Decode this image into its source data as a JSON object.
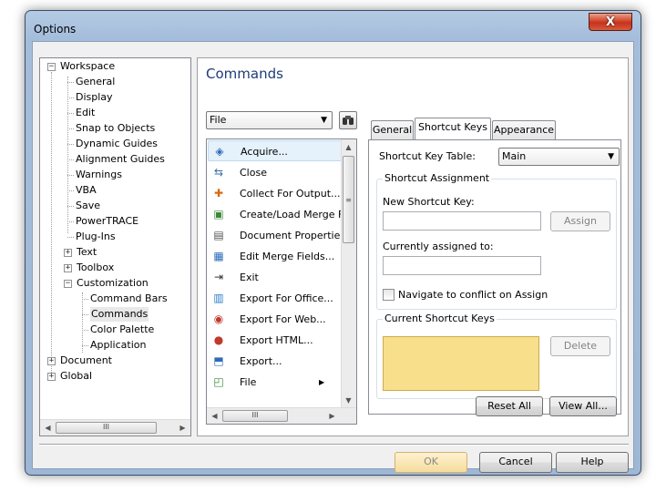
{
  "window": {
    "title": "Options",
    "close_glyph": "X"
  },
  "tree": {
    "items": [
      {
        "label": "Workspace",
        "expander": "−"
      },
      {
        "label": "General"
      },
      {
        "label": "Display"
      },
      {
        "label": "Edit"
      },
      {
        "label": "Snap to Objects"
      },
      {
        "label": "Dynamic Guides"
      },
      {
        "label": "Alignment Guides"
      },
      {
        "label": "Warnings"
      },
      {
        "label": "VBA"
      },
      {
        "label": "Save"
      },
      {
        "label": "PowerTRACE"
      },
      {
        "label": "Plug-Ins"
      },
      {
        "label": "Text",
        "expander": "+"
      },
      {
        "label": "Toolbox",
        "expander": "+"
      },
      {
        "label": "Customization",
        "expander": "−"
      },
      {
        "label": "Command Bars"
      },
      {
        "label": "Commands"
      },
      {
        "label": "Color Palette"
      },
      {
        "label": "Application"
      },
      {
        "label": "Document",
        "expander": "+"
      },
      {
        "label": "Global",
        "expander": "+"
      }
    ],
    "scroll_thumb_glyph": "III"
  },
  "main": {
    "heading": "Commands",
    "category_select": {
      "value": "File"
    },
    "find_icon": "binoculars-icon",
    "commands": [
      {
        "label": "Acquire...",
        "icon": "acquire-icon",
        "glyph": "◈",
        "color": "#2e6bb8"
      },
      {
        "label": "Close",
        "icon": "close-document-icon",
        "glyph": "⇆",
        "color": "#3a6ea5"
      },
      {
        "label": "Collect For Output...",
        "icon": "collect-output-icon",
        "glyph": "✚",
        "color": "#d66a10"
      },
      {
        "label": "Create/Load Merge Fie",
        "icon": "merge-create-icon",
        "glyph": "▣",
        "color": "#3a8a3a"
      },
      {
        "label": "Document Properties...",
        "icon": "document-properties-icon",
        "glyph": "▤",
        "color": "#555555"
      },
      {
        "label": "Edit Merge Fields...",
        "icon": "edit-merge-icon",
        "glyph": "▦",
        "color": "#2e6bb8"
      },
      {
        "label": "Exit",
        "icon": "exit-icon",
        "glyph": "⇥",
        "color": "#333333"
      },
      {
        "label": "Export For Office...",
        "icon": "export-office-icon",
        "glyph": "▥",
        "color": "#2e7bc8"
      },
      {
        "label": "Export For Web...",
        "icon": "export-web-icon",
        "glyph": "◉",
        "color": "#c0392b"
      },
      {
        "label": "Export HTML...",
        "icon": "export-html-icon",
        "glyph": "●",
        "color": "#c0392b"
      },
      {
        "label": "Export...",
        "icon": "export-icon",
        "glyph": "⬒",
        "color": "#2e6bb8"
      },
      {
        "label": "File",
        "icon": "file-icon",
        "glyph": "◰",
        "color": "#3a8a3a",
        "submenu": "▶"
      }
    ],
    "scroll_thumb_glyph": "III",
    "scroll_grip_glyph": "≡"
  },
  "tabs": {
    "items": [
      "General",
      "Shortcut Keys",
      "Appearance"
    ],
    "active": "Shortcut Keys"
  },
  "shortcut": {
    "table_label": "Shortcut Key Table:",
    "table_value": "Main",
    "assignment_group": "Shortcut Assignment",
    "new_key_label": "New Shortcut Key:",
    "new_key_value": "",
    "assign_button": "Assign",
    "assigned_to_label": "Currently assigned to:",
    "assigned_to_value": "",
    "navigate_label": "Navigate to conflict on Assign",
    "navigate_checked": false,
    "current_group": "Current Shortcut Keys",
    "delete_button": "Delete",
    "reset_button": "Reset All",
    "viewall_button": "View All..."
  },
  "footer": {
    "ok": "OK",
    "cancel": "Cancel",
    "help": "Help"
  },
  "scroll_arrows": {
    "up": "▲",
    "down": "▼",
    "left": "◀",
    "right": "▶"
  }
}
